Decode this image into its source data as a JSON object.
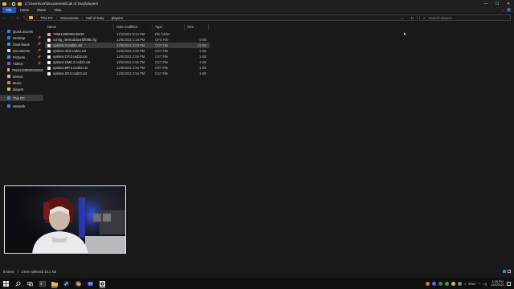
{
  "window": {
    "title": "C:\\Users\\cer\\Documents\\Call of Duty\\players",
    "controls": [
      "—",
      "☐",
      "✕"
    ]
  },
  "ribbon": {
    "tabs": [
      "File",
      "Home",
      "Share",
      "View"
    ],
    "help": "?"
  },
  "nav": {
    "back": "←",
    "forward": "→",
    "recent": "⌄",
    "up": "↑"
  },
  "address": {
    "crumbs": [
      "This PC",
      "Documents",
      "Call of Duty",
      "players"
    ],
    "refresh": "↻",
    "dropdown": "⌄"
  },
  "search": {
    "placeholder": "Search players",
    "icon": "search-icon"
  },
  "sidebar": {
    "items": [
      {
        "label": "Quick access",
        "icon": "star-icon",
        "color": "#3c8ad8"
      },
      {
        "label": "Desktop",
        "icon": "desktop-icon",
        "color": "#2f7bd6",
        "pinned": true
      },
      {
        "label": "Downloads",
        "icon": "download-icon",
        "color": "#2f9bd6",
        "pinned": true
      },
      {
        "label": "Documents",
        "icon": "documents-icon",
        "color": "#d9d9d9",
        "pinned": true
      },
      {
        "label": "Pictures",
        "icon": "pictures-icon",
        "color": "#3d8fd8",
        "pinned": true
      },
      {
        "label": "Videos",
        "icon": "videos-icon",
        "color": "#7c5cd6",
        "pinned": true
      },
      {
        "label": "76561198090240481",
        "icon": "folder-icon",
        "color": "#e8b84a"
      },
      {
        "label": "demos",
        "icon": "folder-icon",
        "color": "#e8b84a"
      },
      {
        "label": "Music",
        "icon": "music-icon",
        "color": "#d9763c"
      },
      {
        "label": "players",
        "icon": "folder-icon",
        "color": "#e8b84a"
      },
      {
        "label": "This PC",
        "icon": "computer-icon",
        "color": "#3c8ad8"
      },
      {
        "label": "Network",
        "icon": "network-icon",
        "color": "#3c8ad8"
      }
    ]
  },
  "columns": [
    "Name",
    "Date modified",
    "Type",
    "Size"
  ],
  "files": [
    {
      "name": "76561198090240481",
      "date": "12/1/2021 9:24 PM",
      "type": "File folder",
      "size": "",
      "kind": "folder"
    },
    {
      "name": "config_r5e9cabba4f2f09b.cfg",
      "date": "12/5/2021 1:18 PM",
      "type": "CFG File",
      "size": "4 KB",
      "kind": "doc"
    },
    {
      "name": "options.3.cod22.cst",
      "date": "12/5/2021 3:00 PM",
      "type": "CST File",
      "size": "11 KB",
      "kind": "doc",
      "selected": true
    },
    {
      "name": "options.4K3.cod22.cst",
      "date": "12/5/2021 2:55 PM",
      "type": "CST File",
      "size": "1 KB",
      "kind": "doc"
    },
    {
      "name": "options.CP.3.cod22.cst",
      "date": "12/5/2021 2:55 PM",
      "type": "CST File",
      "size": "1 KB",
      "kind": "doc"
    },
    {
      "name": "options.DMZ.3.cod22.cst",
      "date": "12/5/2021 2:55 PM",
      "type": "CST File",
      "size": "1 KB",
      "kind": "doc"
    },
    {
      "name": "options.MP.3.cod22.cst",
      "date": "12/5/2021 2:55 PM",
      "type": "CST File",
      "size": "1 KB",
      "kind": "doc"
    },
    {
      "name": "options.SP.3.cod22.cst",
      "date": "12/5/2021 2:55 PM",
      "type": "CST File",
      "size": "1 KB",
      "kind": "doc"
    }
  ],
  "status": {
    "items": "8 items",
    "selection": "1 item selected  10.1 KB"
  },
  "taskbar": {
    "apps": [
      "windows-start-icon",
      "search-icon",
      "task-view-icon",
      "terminal-icon",
      "file-explorer-icon",
      "steam-icon",
      "chrome-icon",
      "discord-icon",
      "obs-icon"
    ],
    "lang": "ENG",
    "time": "4:05 PM",
    "date": "12/5/2021"
  },
  "colors": {
    "accent": "#1e5ab4",
    "folder": "#e8b84a",
    "background": "#191919"
  }
}
